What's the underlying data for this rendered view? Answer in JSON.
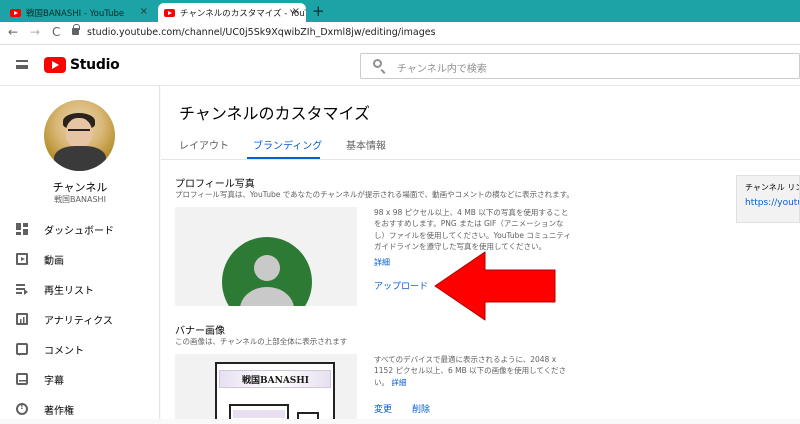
{
  "browser": {
    "tabs": [
      {
        "title": "戦国BANASHI - YouTube",
        "active": false
      },
      {
        "title": "チャンネルのカスタマイズ - YouTube S",
        "active": true
      }
    ],
    "new_tab": "+",
    "tab_close": "×",
    "back": "←",
    "forward": "→",
    "reload": "C",
    "url": "studio.youtube.com/channel/UC0j5Sk9XqwibZIh_Dxml8jw/editing/images"
  },
  "header": {
    "brand": "Studio",
    "search_placeholder": "チャンネル内で検索"
  },
  "sidebar": {
    "channel_name": "チャンネル",
    "channel_handle": "戦国BANASHI",
    "items": [
      {
        "label": "ダッシュボード",
        "icon": "dashboard-icon"
      },
      {
        "label": "動画",
        "icon": "video-icon"
      },
      {
        "label": "再生リスト",
        "icon": "playlist-icon"
      },
      {
        "label": "アナリティクス",
        "icon": "analytics-icon"
      },
      {
        "label": "コメント",
        "icon": "comment-icon"
      },
      {
        "label": "字幕",
        "icon": "subtitles-icon"
      },
      {
        "label": "著作権",
        "icon": "copyright-icon"
      }
    ]
  },
  "main": {
    "title": "チャンネルのカスタマイズ",
    "tabs": [
      {
        "label": "レイアウト",
        "active": false
      },
      {
        "label": "ブランディング",
        "active": true
      },
      {
        "label": "基本情報",
        "active": false
      }
    ],
    "profile": {
      "title": "プロフィール写真",
      "description": "プロフィール写真は、YouTube であなたのチャンネルが提示される場面で、動画やコメントの横などに表示されます。",
      "info_lines": [
        "98 x 98 ピクセル以上、4 MB 以下の写真を使用すること",
        "をおすすめします。PNG または GIF（アニメーションな",
        "し）ファイルを使用してください。YouTube コミュニティ",
        "ガイドラインを遵守した写真を使用してください。"
      ],
      "details_link": "詳細",
      "upload_button": "アップロード"
    },
    "banner": {
      "title": "バナー画像",
      "description": "この画像は、チャンネルの上部全体に表示されます",
      "info_lines": [
        "すべてのデバイスで最適に表示されるように、2048 x",
        "1152 ピクセル以上、6 MB 以下の画像を使用してくださ"
      ],
      "info_tail": "い。",
      "details_link": "詳細",
      "change_button": "変更",
      "delete_button": "削除",
      "preview_text": "戦国BANASHI"
    }
  },
  "right_panel": {
    "label": "チャンネル リンク",
    "link": "https://youtube.com"
  },
  "colors": {
    "accent_blue": "#065fd4",
    "youtube_red": "#ff0000",
    "annotation_arrow": "#ff0000"
  }
}
